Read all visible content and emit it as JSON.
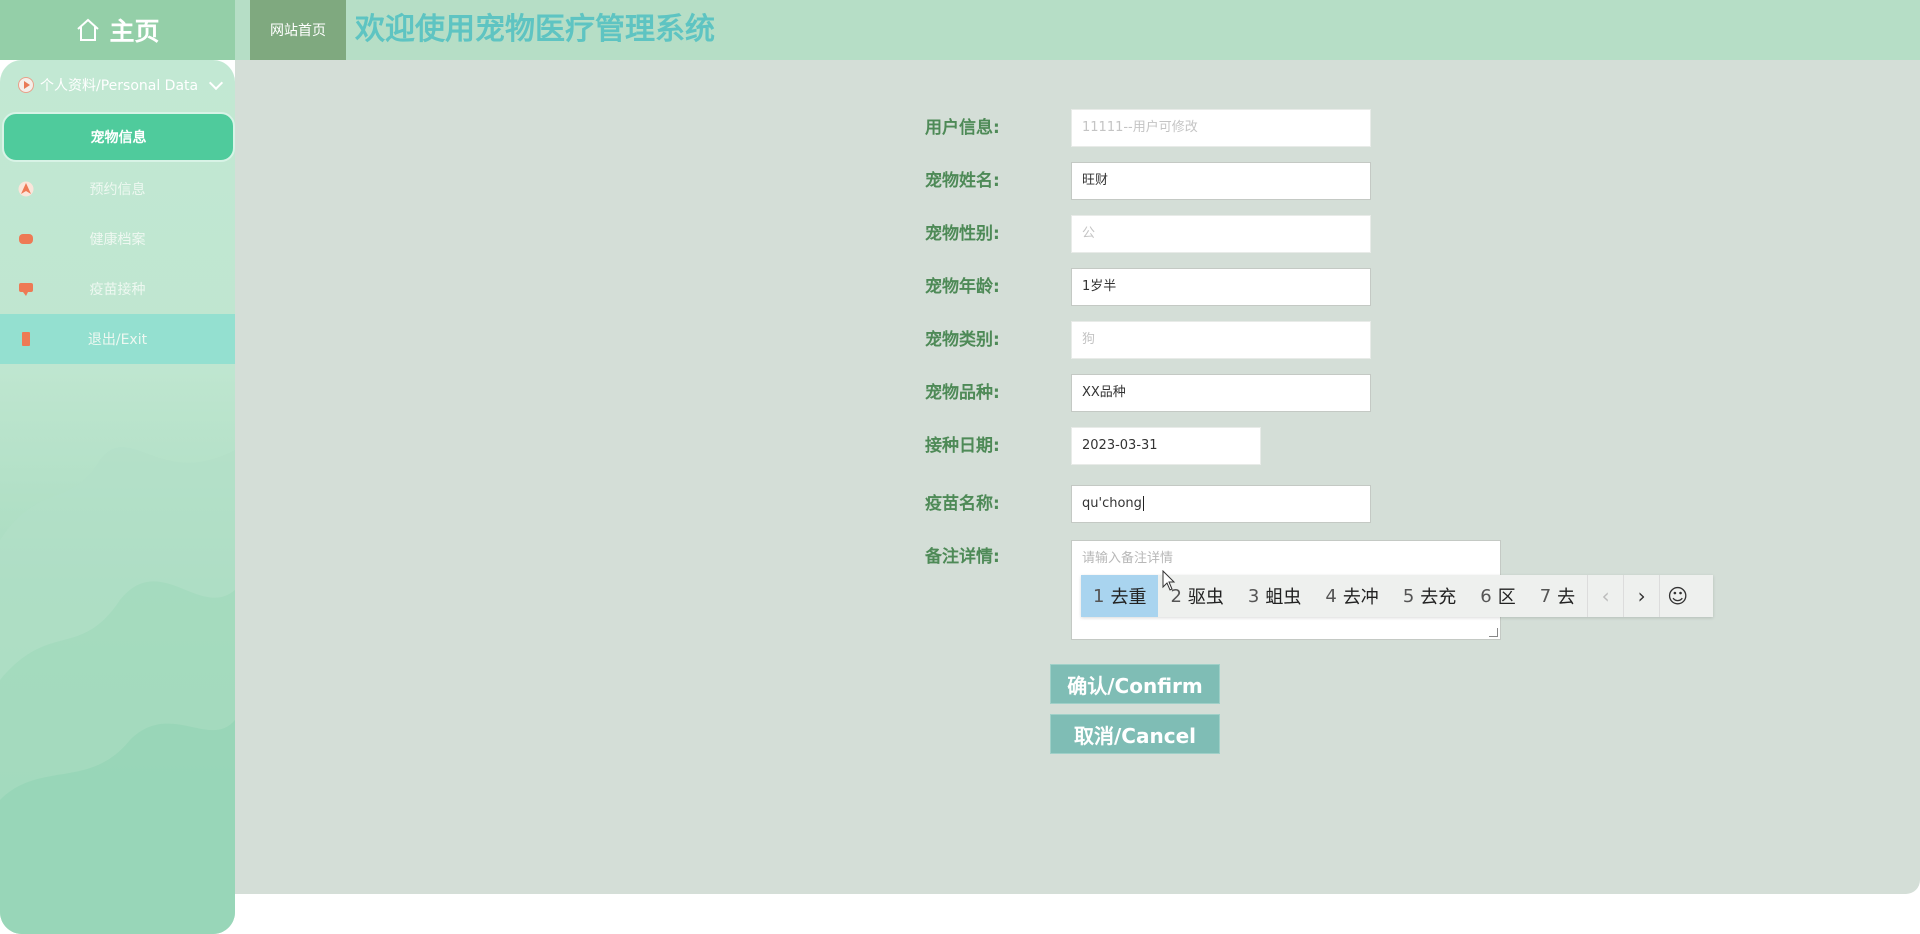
{
  "header": {
    "home_label": "主页",
    "site_home_label": "网站首页",
    "title": "欢迎使用宠物医疗管理系统"
  },
  "sidebar": {
    "group_label": "个人资料/Personal Data",
    "items": [
      {
        "label": "宠物信息",
        "icon": "none",
        "active": true
      },
      {
        "label": "预约信息",
        "icon": "navigation-arrow-icon"
      },
      {
        "label": "健康档案",
        "icon": "chat-bubble-icon"
      },
      {
        "label": "疫苗接种",
        "icon": "comment-icon"
      },
      {
        "label": "退出/Exit",
        "icon": "door-icon"
      }
    ]
  },
  "form": {
    "fields": [
      {
        "label": "用户信息:",
        "value": "",
        "placeholder": "11111--用户可修改",
        "kind": "readonly"
      },
      {
        "label": "宠物姓名:",
        "value": "旺财",
        "placeholder": "",
        "kind": "text"
      },
      {
        "label": "宠物性别:",
        "value": "",
        "placeholder": "公",
        "kind": "readonly"
      },
      {
        "label": "宠物年龄:",
        "value": "1岁半",
        "placeholder": "",
        "kind": "text"
      },
      {
        "label": "宠物类别:",
        "value": "",
        "placeholder": "狗",
        "kind": "readonly"
      },
      {
        "label": "宠物品种:",
        "value": "XX品种",
        "placeholder": "",
        "kind": "text"
      },
      {
        "label": "接种日期:",
        "value": "2023-03-31",
        "placeholder": "",
        "kind": "date"
      },
      {
        "label": "疫苗名称:",
        "value": "qu'chong",
        "placeholder": "",
        "kind": "text"
      }
    ],
    "note": {
      "label": "备注详情:",
      "placeholder": "请输入备注详情"
    },
    "confirm_label": "确认/Confirm",
    "cancel_label": "取消/Cancel"
  },
  "ime": {
    "candidates": [
      {
        "num": "1",
        "text": "去重"
      },
      {
        "num": "2",
        "text": "驱虫"
      },
      {
        "num": "3",
        "text": "蛆虫"
      },
      {
        "num": "4",
        "text": "去冲"
      },
      {
        "num": "5",
        "text": "去充"
      },
      {
        "num": "6",
        "text": "区"
      },
      {
        "num": "7",
        "text": "去"
      }
    ],
    "prev": "‹",
    "next": "›",
    "emoji": "☺"
  },
  "colors": {
    "accent": "#4fcb9c",
    "title": "#5ec4c2",
    "label": "#4e8a57",
    "button": "#7fbdb5"
  }
}
